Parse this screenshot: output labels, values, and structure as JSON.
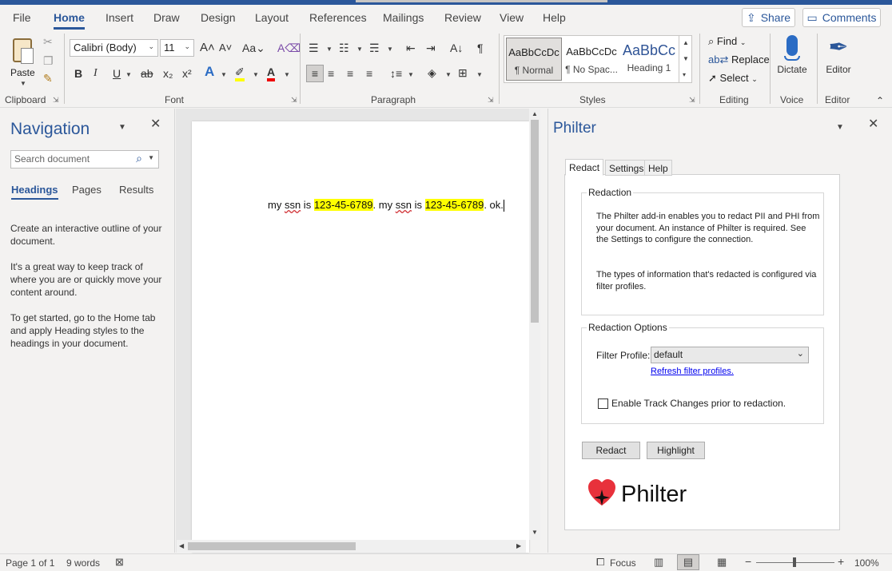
{
  "menu": {
    "tabs": [
      "File",
      "Home",
      "Insert",
      "Draw",
      "Design",
      "Layout",
      "References",
      "Mailings",
      "Review",
      "View",
      "Help"
    ],
    "share": "Share",
    "comments": "Comments"
  },
  "ribbon": {
    "clipboard": {
      "paste": "Paste",
      "label": "Clipboard"
    },
    "font": {
      "family": "Calibri (Body)",
      "size": "11",
      "label": "Font"
    },
    "paragraph": {
      "label": "Paragraph"
    },
    "styles": {
      "label": "Styles",
      "items": [
        {
          "sample": "AaBbCcDc",
          "name": "¶ Normal"
        },
        {
          "sample": "AaBbCcDc",
          "name": "¶ No Spac..."
        },
        {
          "sample": "AaBbCc",
          "name": "Heading 1"
        }
      ]
    },
    "editing": {
      "find": "Find",
      "replace": "Replace",
      "select": "Select",
      "label": "Editing"
    },
    "voice": {
      "dictate": "Dictate",
      "label": "Voice"
    },
    "editor": {
      "editor": "Editor",
      "label": "Editor"
    }
  },
  "navigation": {
    "title": "Navigation",
    "search_placeholder": "Search document",
    "tabs": [
      "Headings",
      "Pages",
      "Results"
    ],
    "paragraphs": [
      "Create an interactive outline of your document.",
      "It's a great way to keep track of where you are or quickly move your content around.",
      "To get started, go to the Home tab and apply Heading styles to the headings in your document."
    ]
  },
  "document": {
    "segments": [
      "my ",
      "ssn",
      " is ",
      "123-45-6789",
      ". my ",
      "ssn",
      " is ",
      "123-45-6789",
      ". ok."
    ]
  },
  "philter": {
    "title": "Philter",
    "tabs": [
      "Redact",
      "Settings",
      "Help"
    ],
    "redaction": {
      "legend": "Redaction",
      "p1": "The Philter add-in enables you to redact PII and PHI from your document. An instance of Philter is required. See the Settings to configure the connection.",
      "p2": "The types of information that's redacted is configured via filter profiles."
    },
    "options": {
      "legend": "Redaction Options",
      "filter_label": "Filter Profile:",
      "filter_value": "default",
      "refresh": "Refresh filter profiles.",
      "track_changes": "Enable Track Changes prior to redaction."
    },
    "buttons": {
      "redact": "Redact",
      "highlight": "Highlight"
    },
    "logo_text": "Philter"
  },
  "status": {
    "page": "Page 1 of 1",
    "words": "9 words",
    "focus": "Focus",
    "zoom": "100%"
  },
  "colors": {
    "accent": "#2b579a",
    "highlight": "#ffff00",
    "logo_red": "#e8313b"
  }
}
